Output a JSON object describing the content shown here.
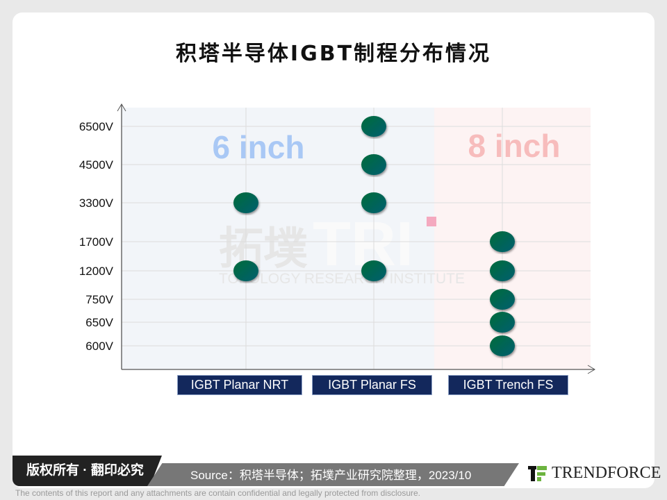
{
  "title": "积塔半导体IGBT制程分布情况",
  "chart_data": {
    "type": "scatter",
    "title": "积塔半导体IGBT制程分布情况",
    "categories": [
      "IGBT Planar NRT",
      "IGBT Planar FS",
      "IGBT Trench FS"
    ],
    "y_categories": [
      "600V",
      "650V",
      "750V",
      "1200V",
      "1700V",
      "3300V",
      "4500V",
      "6500V"
    ],
    "regions": [
      {
        "label": "6  inch",
        "categories": [
          "IGBT Planar NRT",
          "IGBT Planar FS"
        ],
        "color": "#f2f5f9",
        "label_color": "#a9c8f5"
      },
      {
        "label": "8  inch",
        "categories": [
          "IGBT Trench FS"
        ],
        "color": "#fdf3f3",
        "label_color": "#f7bcbc"
      }
    ],
    "points": [
      {
        "x": "IGBT Planar NRT",
        "y": "3300V"
      },
      {
        "x": "IGBT Planar NRT",
        "y": "1200V"
      },
      {
        "x": "IGBT Planar FS",
        "y": "6500V"
      },
      {
        "x": "IGBT Planar FS",
        "y": "4500V"
      },
      {
        "x": "IGBT Planar FS",
        "y": "3300V"
      },
      {
        "x": "IGBT Planar FS",
        "y": "1200V"
      },
      {
        "x": "IGBT Trench FS",
        "y": "1700V"
      },
      {
        "x": "IGBT Trench FS",
        "y": "1200V"
      },
      {
        "x": "IGBT Trench FS",
        "y": "750V"
      },
      {
        "x": "IGBT Trench FS",
        "y": "650V"
      },
      {
        "x": "IGBT Trench FS",
        "y": "600V"
      }
    ],
    "grid": true,
    "point_color": "#006a4a"
  },
  "watermark": {
    "cn": "拓墣",
    "en": "TOPOLOGY RESEARCH INSTITUTE",
    "mark": "TRI"
  },
  "footer": {
    "rights": "版权所有 · 翻印必究",
    "source": "Source：积塔半导体；拓墣产业研究院整理，2023/10",
    "logo": "TRENDFORCE",
    "disclaimer": "The contents of this report and any attachments are contain confidential and legally protected from disclosure."
  }
}
